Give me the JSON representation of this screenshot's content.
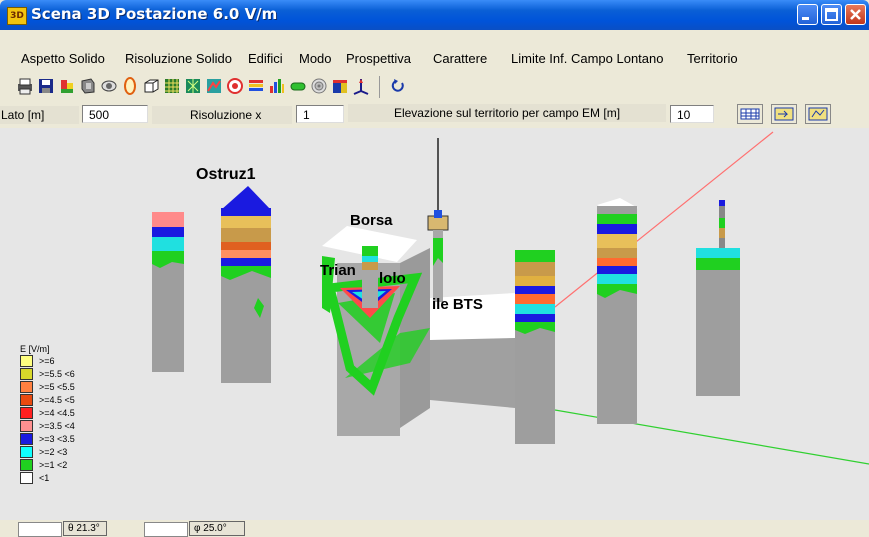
{
  "window": {
    "title": "Scena 3D Postazione 6.0 V/m",
    "icon_text": "3D"
  },
  "menu": [
    "Aspetto Solido",
    "Risoluzione Solido",
    "Edifici",
    "Modo",
    "Prospettiva",
    "Carattere",
    "Limite Inf. Campo Lontano",
    "Territorio"
  ],
  "toolbar": [
    "print-icon",
    "save-icon",
    "color-building-icon",
    "shield-icon",
    "eye-icon",
    "ellipse-icon",
    "box-icon",
    "grid-icon",
    "tree-icon",
    "map-icon",
    "target-icon",
    "scale-icon",
    "bar-chart-icon",
    "pill-icon",
    "sphere-icon",
    "cube-icon",
    "axis-icon",
    "refresh-icon"
  ],
  "params": {
    "lato_label": "Lato [m]",
    "lato_value": "500",
    "risoluzione_label": "Risoluzione x",
    "risoluzione_value": "1",
    "elevazione_label": "Elevazione sul territorio per campo EM [m]",
    "elevazione_value": "10",
    "side_buttons": [
      "calendar-grid-icon",
      "ref-icon",
      "imp-icon"
    ]
  },
  "scene": {
    "labels": {
      "ostruz": "Ostruz1",
      "borsa": "Borsa",
      "triangolo_left": "Trian",
      "triangolo_right": "lolo",
      "bts": "ile BTS"
    },
    "colors": {
      "background": "#e6e6e6",
      "building": "#a8a8a8",
      "building_top": "#ffffff",
      "red_axis": "#ff6b6b",
      "green_axis": "#3ddc3d"
    }
  },
  "legend": {
    "title": "E [V/m]",
    "items": [
      {
        "label": ">=6",
        "color": "#ffff80"
      },
      {
        "label": ">=5.5  <6",
        "color": "#d8d82a"
      },
      {
        "label": ">=5    <5.5",
        "color": "#ff8040"
      },
      {
        "label": ">=4.5  <5",
        "color": "#e84a10"
      },
      {
        "label": ">=4    <4.5",
        "color": "#ff2020"
      },
      {
        "label": ">=3.5  <4",
        "color": "#ff9090"
      },
      {
        "label": ">=3    <3.5",
        "color": "#1a1ae0"
      },
      {
        "label": ">=2    <3",
        "color": "#10ffff"
      },
      {
        "label": ">=1    <2",
        "color": "#20d020"
      },
      {
        "label": "<1",
        "color": "#ffffff"
      }
    ]
  },
  "status": {
    "angle1": "θ 21.3°",
    "angle2": "φ 25.0°"
  }
}
